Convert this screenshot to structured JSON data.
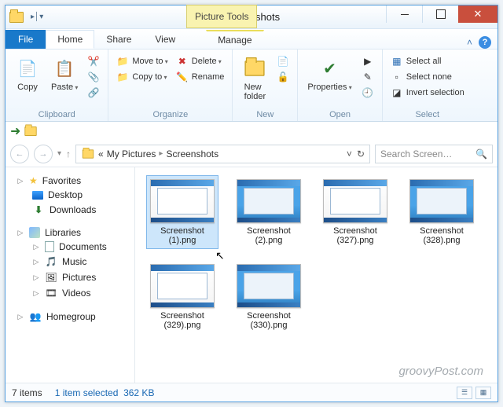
{
  "window": {
    "title": "Screenshots",
    "context_tab": "Picture Tools"
  },
  "tabs": {
    "file": "File",
    "home": "Home",
    "share": "Share",
    "view": "View",
    "manage": "Manage"
  },
  "ribbon": {
    "clipboard": {
      "label": "Clipboard",
      "copy": "Copy",
      "paste": "Paste"
    },
    "organize": {
      "label": "Organize",
      "move_to": "Move to",
      "copy_to": "Copy to",
      "delete": "Delete",
      "rename": "Rename"
    },
    "new": {
      "label": "New",
      "new_folder": "New\nfolder"
    },
    "open": {
      "label": "Open",
      "properties": "Properties"
    },
    "select": {
      "label": "Select",
      "select_all": "Select all",
      "select_none": "Select none",
      "invert": "Invert selection"
    }
  },
  "address": {
    "crumb_prefix": "«",
    "crumb1": "My Pictures",
    "crumb2": "Screenshots"
  },
  "search": {
    "placeholder": "Search Screen…",
    "icon": "🔍"
  },
  "navpane": {
    "favorites": "Favorites",
    "desktop": "Desktop",
    "downloads": "Downloads",
    "libraries": "Libraries",
    "documents": "Documents",
    "music": "Music",
    "pictures": "Pictures",
    "videos": "Videos",
    "homegroup": "Homegroup"
  },
  "files": [
    {
      "name": "Screenshot (1).png",
      "selected": true
    },
    {
      "name": "Screenshot (2).png",
      "selected": false
    },
    {
      "name": "Screenshot (327).png",
      "selected": false
    },
    {
      "name": "Screenshot (328).png",
      "selected": false
    },
    {
      "name": "Screenshot (329).png",
      "selected": false
    },
    {
      "name": "Screenshot (330).png",
      "selected": false
    }
  ],
  "status": {
    "count": "7 items",
    "selection": "1 item selected",
    "size": "362 KB"
  },
  "watermark": "groovyPost.com"
}
